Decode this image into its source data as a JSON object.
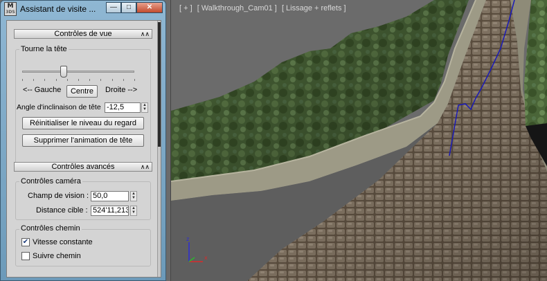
{
  "window": {
    "title": "Assistant de visite ...",
    "icon_line1": "M",
    "icon_line2": "3DS"
  },
  "view_controls": {
    "header": "Contrôles de vue",
    "head_turn_label": "Tourne la tête",
    "head_turn_position": 0.37,
    "left_label": "<-- Gauche",
    "center_button": "Centre",
    "right_label": "Droite -->",
    "tilt_label": "Angle d'inclinaison de tête",
    "tilt_value": "-12,5",
    "reset_button": "Réinitialiser le niveau du regard",
    "delete_button": "Supprimer l'animation de tête"
  },
  "advanced_controls": {
    "header": "Contrôles avancés",
    "camera_group": "Contrôles caméra",
    "fov_label": "Champ de vision :",
    "fov_value": "50,0",
    "target_label": "Distance cible :",
    "target_value": "524'11,213",
    "path_group": "Contrôles chemin",
    "constant_speed_label": "Vitesse constante",
    "constant_speed_checked": true,
    "follow_path_label": "Suivre chemin",
    "follow_path_checked": false
  },
  "viewport": {
    "label_plus": "[ + ]",
    "label_camera": "[ Walkthrough_Cam01 ]",
    "label_shading": "[ Lissage + reflets ]",
    "axis_z": "z",
    "axis_x": "x"
  },
  "colors": {
    "path_line": "#1a1ab8",
    "axis_z": "#2b2bd8",
    "axis_x": "#d82b2b",
    "axis_y": "#2bb82b"
  }
}
